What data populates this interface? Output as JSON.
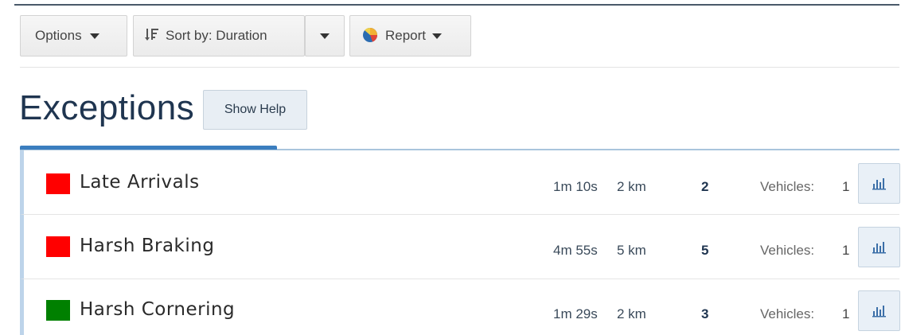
{
  "toolbar": {
    "options_label": "Options",
    "sort_label": "Sort by: Duration",
    "report_label": "Report",
    "icons": {
      "options": "chevron-down-icon",
      "sort": "sort-icon",
      "report": "pie-chart-icon"
    }
  },
  "page": {
    "title": "Exceptions",
    "help_label": "Show Help"
  },
  "colors": {
    "red": "#ff0000",
    "green": "#008000",
    "accent": "#3b7ebf"
  },
  "exceptions": [
    {
      "name": "Late Arrivals",
      "duration": "1m 10s",
      "distance": "2 km",
      "count": "2",
      "vehicles_label": "Vehicles:",
      "vehicles": "1",
      "color": "#ff0000"
    },
    {
      "name": "Harsh Braking",
      "duration": "4m 55s",
      "distance": "5 km",
      "count": "5",
      "vehicles_label": "Vehicles:",
      "vehicles": "1",
      "color": "#ff0000"
    },
    {
      "name": "Harsh Cornering",
      "duration": "1m 29s",
      "distance": "2 km",
      "count": "3",
      "vehicles_label": "Vehicles:",
      "vehicles": "1",
      "color": "#008000"
    }
  ]
}
